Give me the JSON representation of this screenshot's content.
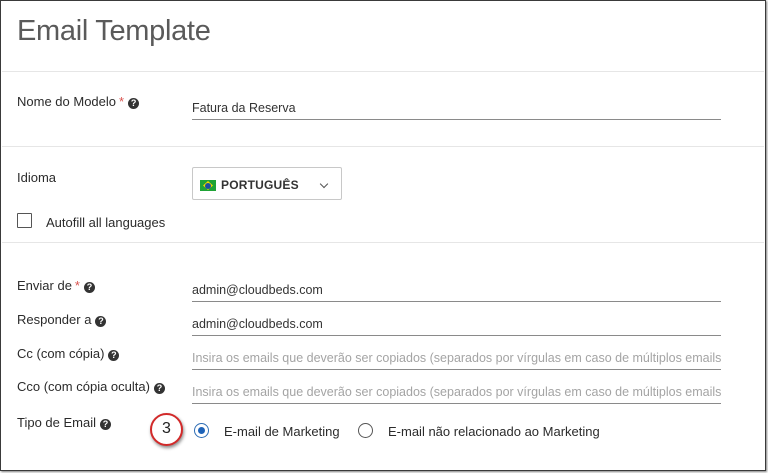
{
  "page": {
    "title": "Email Template"
  },
  "template_name": {
    "label": "Nome do Modelo",
    "required_mark": "*",
    "value": "Fatura da Reserva"
  },
  "language": {
    "label": "Idioma",
    "selected": "PORTUGUÊS",
    "flag_icon": "brazil-flag-icon",
    "autofill_label": "Autofill all languages",
    "autofill_checked": false
  },
  "send_from": {
    "label": "Enviar de",
    "required_mark": "*",
    "value": "admin@cloudbeds.com"
  },
  "reply_to": {
    "label": "Responder a",
    "value": "admin@cloudbeds.com"
  },
  "cc": {
    "label": "Cc (com cópia)",
    "value": "",
    "placeholder": "Insira os emails que deverão ser copiados (separados por vírgulas em caso de múltiplos emails"
  },
  "bcc": {
    "label": "Cco (com cópia oculta)",
    "value": "",
    "placeholder": "Insira os emails que deverão ser copiados (separados por vírgulas em caso de múltiplos emails"
  },
  "email_type": {
    "label": "Tipo de Email",
    "options": [
      {
        "label": "E-mail de Marketing",
        "selected": true
      },
      {
        "label": "E-mail não relacionado ao Marketing",
        "selected": false
      }
    ]
  },
  "callout": {
    "number": "3",
    "color": "#d22a2a"
  },
  "colors": {
    "required": "#d9534f",
    "radio_accent": "#1e63b8",
    "flag_green": "#1fa336",
    "flag_yellow": "#f5d400",
    "flag_blue": "#1d4fa0"
  }
}
